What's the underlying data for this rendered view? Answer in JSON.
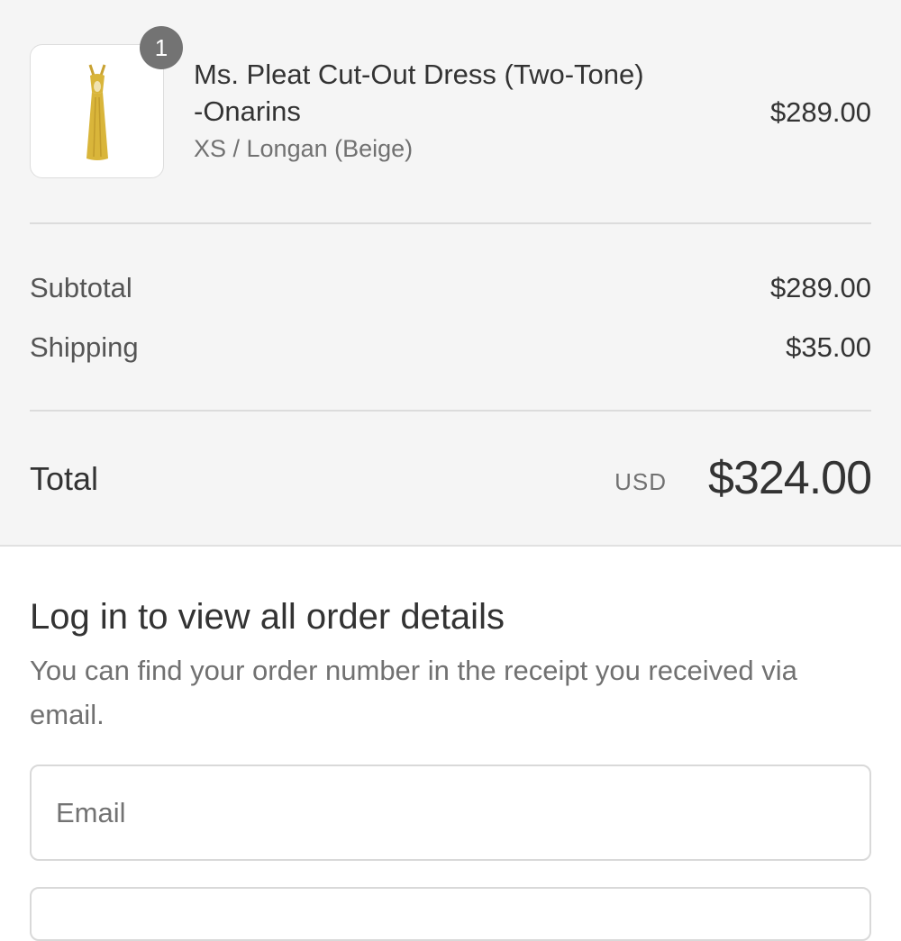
{
  "cart": {
    "item": {
      "quantity": "1",
      "name_line1": "Ms. Pleat Cut-Out Dress (Two-Tone)",
      "name_line2": "-Onarins",
      "variant": "XS / Longan (Beige)",
      "price": "$289.00",
      "image_icon": "dress-thumbnail",
      "image_color": "#d9b53a"
    }
  },
  "summary": {
    "subtotal_label": "Subtotal",
    "subtotal_value": "$289.00",
    "shipping_label": "Shipping",
    "shipping_value": "$35.00",
    "total_label": "Total",
    "currency": "USD",
    "total_value": "$324.00"
  },
  "login": {
    "title": "Log in to view all order details",
    "description": "You can find your order number in the receipt you received via email.",
    "email_placeholder": "Email",
    "email_value": ""
  },
  "colors": {
    "summary_background": "#f5f5f5",
    "badge_background": "#737373",
    "text_primary": "#333333",
    "text_secondary": "#717171"
  }
}
